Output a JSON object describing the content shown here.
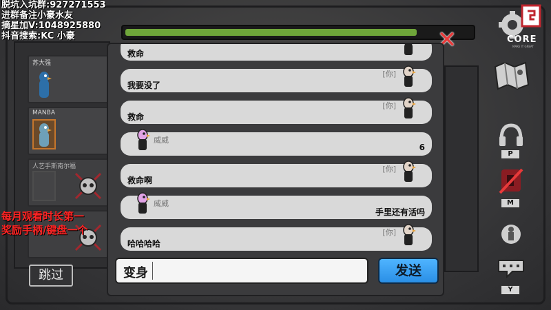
{
  "overlay": {
    "lines": [
      "脱坑入坑群:927271553",
      "进群备注小豪水友",
      "摘星加V:1048925880",
      "抖音搜索:KC 小豪"
    ],
    "promo": [
      "每月观看时长第一",
      "奖励手柄/键盘一个"
    ]
  },
  "players": [
    {
      "name": "苏大强"
    },
    {
      "name": "MANBA"
    },
    {
      "name": "人艺手斯南尔福"
    }
  ],
  "skip_label": "跳过",
  "progress": {
    "fraction": 0.84,
    "color": "#6fa63a"
  },
  "close_icon": "close-icon",
  "chat": {
    "messages": [
      {
        "text": "救命",
        "tag": "",
        "sender": "",
        "align": "left",
        "avatar": "goose-grey"
      },
      {
        "text": "我要没了",
        "tag": "[你]",
        "sender": "",
        "align": "left",
        "avatar": "goose-grey"
      },
      {
        "text": "救命",
        "tag": "[你]",
        "sender": "",
        "align": "left",
        "avatar": "goose-grey"
      },
      {
        "text": "6",
        "tag": "",
        "sender": "威威",
        "align": "right",
        "avatar": "goose-pink"
      },
      {
        "text": "救命啊",
        "tag": "[你]",
        "sender": "",
        "align": "left",
        "avatar": "goose-grey"
      },
      {
        "text": "手里还有活吗",
        "tag": "",
        "sender": "威威",
        "align": "right",
        "avatar": "goose-pink"
      },
      {
        "text": "哈哈哈哈",
        "tag": "[你]",
        "sender": "",
        "align": "left",
        "avatar": "goose-grey"
      }
    ],
    "input_value": "变身",
    "send_label": "发送"
  },
  "right_panel": {
    "logo": "CORE",
    "logo_sub": "MAKE IT GREAT",
    "keys": [
      "P",
      "M",
      "Y"
    ]
  },
  "colors": {
    "accent_blue": "#2a8fe6",
    "danger_red": "#e83a3a",
    "bubble": "#d9d9d9"
  }
}
